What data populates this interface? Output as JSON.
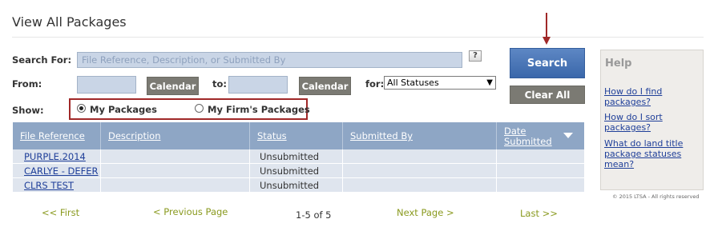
{
  "page": {
    "title": "View All Packages"
  },
  "search": {
    "label": "Search For:",
    "placeholder": "File Reference, Description, or Submitted By",
    "help_icon": "?"
  },
  "date_range": {
    "from_label": "From:",
    "to_label": "to:",
    "calendar_label": "Calendar",
    "for_label": "for:",
    "status_selected": "All Statuses"
  },
  "show": {
    "label": "Show:",
    "options": [
      {
        "label": "My Packages",
        "selected": true
      },
      {
        "label": "My Firm's Packages",
        "selected": false
      }
    ]
  },
  "buttons": {
    "search": "Search",
    "clear_all": "Clear All"
  },
  "table": {
    "columns": [
      "File Reference",
      "Description",
      "Status",
      "Submitted By",
      "Date",
      "Submitted"
    ],
    "rows": [
      {
        "file_reference": "PURPLE.2014",
        "description": "",
        "status": "Unsubmitted",
        "submitted_by": "",
        "date_submitted": ""
      },
      {
        "file_reference": "CARLYE - DEFER",
        "description": "",
        "status": "Unsubmitted",
        "submitted_by": "",
        "date_submitted": ""
      },
      {
        "file_reference": "CLRS TEST",
        "description": "",
        "status": "Unsubmitted",
        "submitted_by": "",
        "date_submitted": ""
      }
    ]
  },
  "pagination": {
    "first": "<< First",
    "previous": "< Previous Page",
    "count": "1-5 of 5",
    "next": "Next Page >",
    "last": "Last >>"
  },
  "help": {
    "title": "Help",
    "links": [
      "How do I find packages?",
      "How do I sort packages?",
      "What do land title package statuses mean?"
    ]
  },
  "footer": {
    "copyright": "© 2015 LTSA - All rights reserved"
  },
  "colors": {
    "accent_blue": "#3a67aa",
    "header_blue": "#8ea6c5",
    "row_blue": "#dfe5ee",
    "highlight_red": "#a02828",
    "pager_green": "#8a9a1f",
    "button_gray": "#7b7a73"
  }
}
